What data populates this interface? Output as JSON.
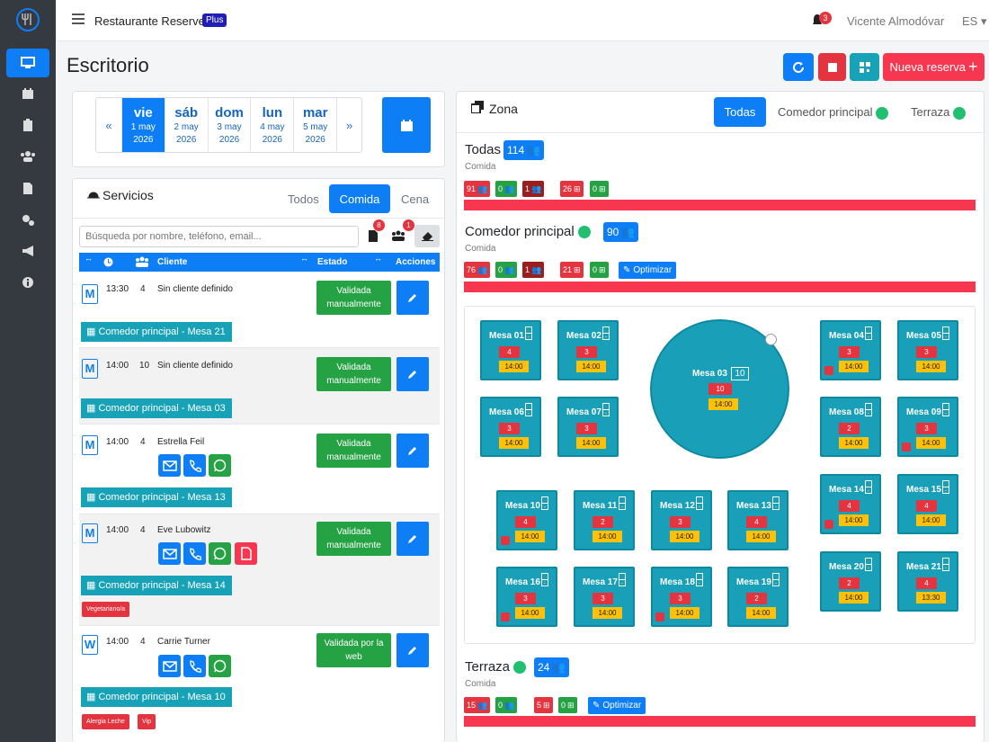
{
  "app": {
    "title": "Restaurante Reserver",
    "plan_badge": "Plus",
    "notification_count": "3",
    "user": "Vicente Almodóvar",
    "language": "ES"
  },
  "page": {
    "title": "Escritorio",
    "new_reservation": "Nueva reserva"
  },
  "dates": [
    {
      "day": "vie",
      "date": "1 may",
      "year": "2026"
    },
    {
      "day": "sáb",
      "date": "2 may",
      "year": "2026"
    },
    {
      "day": "dom",
      "date": "3 may",
      "year": "2026"
    },
    {
      "day": "lun",
      "date": "4 may",
      "year": "2026"
    },
    {
      "day": "mar",
      "date": "5 may",
      "year": "2026"
    }
  ],
  "date_nav": {
    "prev": "«",
    "next": "»"
  },
  "services": {
    "title": "Servicios",
    "tabs": [
      "Todos",
      "Comida",
      "Cena"
    ],
    "active_tab": "Comida",
    "search_placeholder": "Búsqueda por nombre, teléfono, email...",
    "doc_badge": "8",
    "group_badge": "1"
  },
  "table_headers": {
    "client": "Cliente",
    "status": "Estado",
    "actions": "Acciones"
  },
  "reservations": [
    {
      "initial": "M",
      "time": "13:30",
      "people": "4",
      "client": "Sin cliente definido",
      "status": "Validada manualmente",
      "zone": "Comedor principal - Mesa 21",
      "tags": []
    },
    {
      "initial": "M",
      "time": "14:00",
      "people": "10",
      "client": "Sin cliente definido",
      "status": "Validada manualmente",
      "zone": "Comedor principal - Mesa 03",
      "tags": []
    },
    {
      "initial": "M",
      "time": "14:00",
      "people": "4",
      "client": "Estrella Feil",
      "status": "Validada manualmente",
      "zone": "Comedor principal - Mesa 13",
      "tags": []
    },
    {
      "initial": "M",
      "time": "14:00",
      "people": "4",
      "client": "Eve Lubowitz",
      "status": "Validada manualmente",
      "zone": "Comedor principal - Mesa 14",
      "tags": [
        "Vegetariano/a"
      ]
    },
    {
      "initial": "W",
      "time": "14:00",
      "people": "4",
      "client": "Carrie Turner",
      "status": "Validada por la web",
      "zone": "Comedor principal - Mesa 10",
      "tags": [
        "Alergia Leche",
        "Vip"
      ]
    }
  ],
  "zone_panel": {
    "title": "Zona",
    "tabs": [
      "Todas",
      "Comedor principal",
      "Terraza"
    ]
  },
  "summary": [
    {
      "title": "Todas",
      "count": "114",
      "subtitle": "Comida",
      "chips": [
        "91",
        "0",
        "1",
        "26",
        "0"
      ]
    },
    {
      "title": "Comedor principal",
      "count": "90",
      "subtitle": "Comida",
      "chips": [
        "76",
        "0",
        "1",
        "21",
        "0"
      ],
      "optimize": "Optimizar"
    },
    {
      "title": "Terraza",
      "count": "24",
      "subtitle": "Comida",
      "chips": [
        "15",
        "0",
        "5",
        "0"
      ],
      "optimize": "Optimizar"
    }
  ],
  "tables": [
    {
      "name": "Mesa 01",
      "people": "4",
      "time": "14:00"
    },
    {
      "name": "Mesa 02",
      "people": "3",
      "time": "14:00"
    },
    {
      "name": "Mesa 03",
      "seats": "10",
      "people": "10",
      "time": "14:00"
    },
    {
      "name": "Mesa 04",
      "people": "3",
      "time": "14:00"
    },
    {
      "name": "Mesa 05",
      "people": "3",
      "time": "14:00"
    },
    {
      "name": "Mesa 06",
      "people": "3",
      "time": "14:00"
    },
    {
      "name": "Mesa 07",
      "people": "3",
      "time": "14:00"
    },
    {
      "name": "Mesa 08",
      "people": "2",
      "time": "14:00"
    },
    {
      "name": "Mesa 09",
      "people": "3",
      "time": "14:00"
    },
    {
      "name": "Mesa 10",
      "people": "4",
      "time": "14:00"
    },
    {
      "name": "Mesa 11",
      "people": "2",
      "time": "14:00"
    },
    {
      "name": "Mesa 12",
      "people": "3",
      "time": "14:00"
    },
    {
      "name": "Mesa 13",
      "people": "4",
      "time": "14:00"
    },
    {
      "name": "Mesa 14",
      "people": "4",
      "time": "14:00"
    },
    {
      "name": "Mesa 15",
      "people": "4",
      "time": "14:00"
    },
    {
      "name": "Mesa 16",
      "people": "3",
      "time": "14:00"
    },
    {
      "name": "Mesa 17",
      "people": "3",
      "time": "14:00"
    },
    {
      "name": "Mesa 18",
      "people": "3",
      "time": "14:00"
    },
    {
      "name": "Mesa 19",
      "people": "2",
      "time": "14:00"
    },
    {
      "name": "Mesa 20",
      "people": "2",
      "time": "14:00"
    },
    {
      "name": "Mesa 21",
      "people": "4",
      "time": "13:30"
    }
  ],
  "colors": {
    "primary": "#0d7ef5",
    "success": "#25a244",
    "danger": "#e3343f",
    "teal": "#19a0b8",
    "warning": "#ffc107",
    "dark_red": "#9b1d1d"
  },
  "icons": [
    "desktop-icon",
    "calendar-icon",
    "clipboard-icon",
    "users-icon",
    "file-icon",
    "cogs-icon",
    "megaphone-icon",
    "info-icon",
    "sync-icon",
    "stop-icon",
    "qrcode-icon",
    "bell-icon"
  ]
}
